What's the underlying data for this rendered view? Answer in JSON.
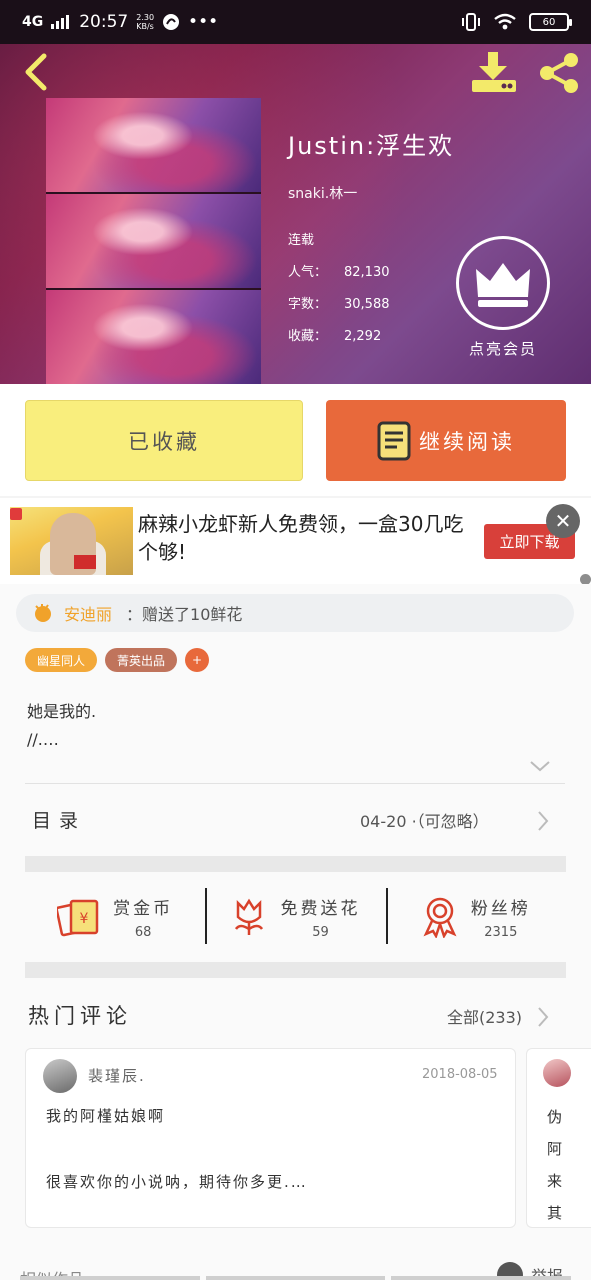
{
  "status_bar": {
    "network": "4G",
    "time": "20:57",
    "speed_value": "2.30",
    "speed_unit": "KB/s",
    "more": "•••",
    "battery": "60"
  },
  "book": {
    "title": "Justin:浮生欢",
    "author": "snaki.林一",
    "status": "连载",
    "popularity_label": "人气：",
    "popularity": "82,130",
    "words_label": "字数：",
    "words": "30,588",
    "favorites_label": "收藏：",
    "favorites": "2,292",
    "vip_label": "点亮会员"
  },
  "actions": {
    "collected_label": "已收藏",
    "continue_label": "继续阅读"
  },
  "ad": {
    "text": "麻辣小龙虾新人免费领，一盒30几吃个够!",
    "download_label": "立即下载",
    "close": "✕"
  },
  "gift": {
    "user": "安迪丽",
    "text": "：赠送了10鲜花"
  },
  "tags": [
    "幽星同人",
    "菁英出品",
    "+"
  ],
  "summary": {
    "line1": "她是我的.",
    "line2": "//.…"
  },
  "toc": {
    "title": "目录",
    "latest": "04-20 ·（可忽略）"
  },
  "stats": [
    {
      "label": "赏金币",
      "count": "68",
      "icon": "coin-envelope-icon"
    },
    {
      "label": "免费送花",
      "count": "59",
      "icon": "flower-icon"
    },
    {
      "label": "粉丝榜",
      "count": "2315",
      "icon": "ribbon-medal-icon"
    }
  ],
  "comments": {
    "title": "热门评论",
    "all_label": "全部(233)",
    "items": [
      {
        "name": "裴瑾辰.",
        "date": "2018-08-05",
        "line1": "我的阿槿姑娘啊",
        "line2": "很喜欢你的小说呐，期待你多更.…"
      },
      {
        "text": "伪阿来其"
      }
    ]
  },
  "footer": {
    "similar_label": "相似作品",
    "report_label": "举报"
  },
  "colors": {
    "accent_orange": "#e8693b",
    "collected_yellow": "#f9ee7d",
    "gift_user_orange": "#f0a22a",
    "hero_magenta": "#7a1e4a"
  }
}
